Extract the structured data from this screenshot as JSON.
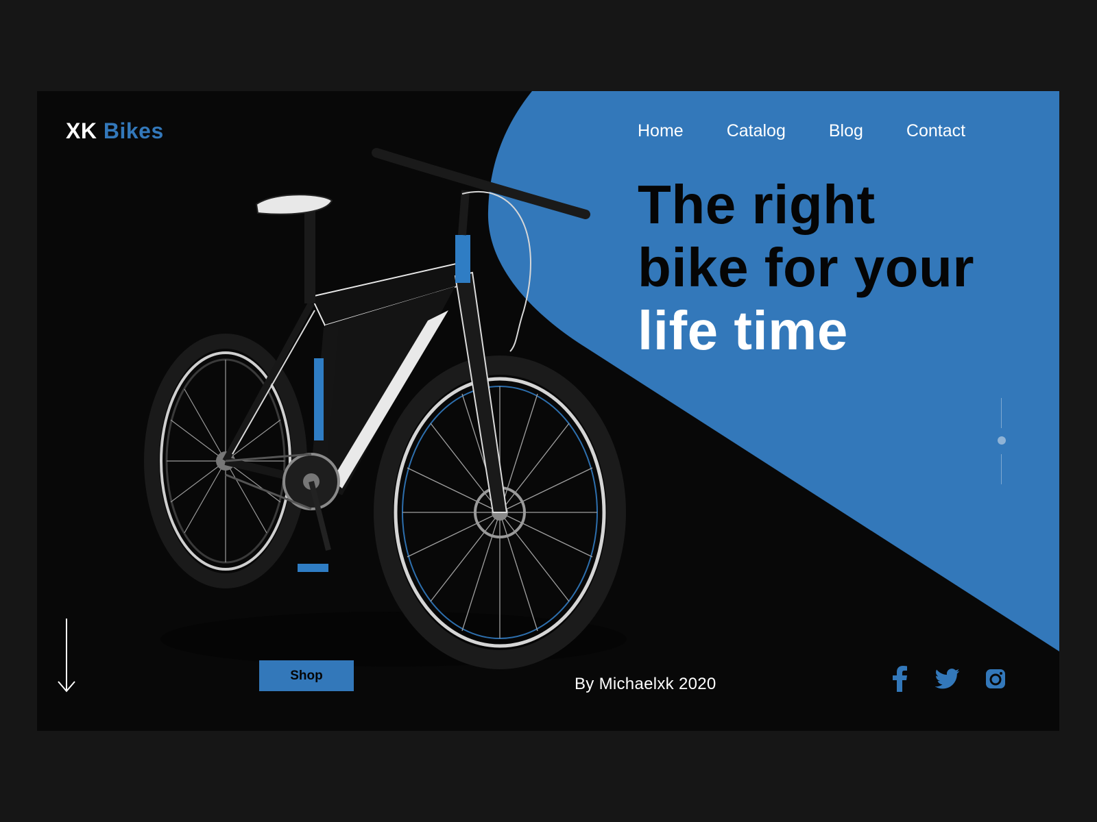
{
  "brand": {
    "name_part1": "XK",
    "name_part2": "Bikes"
  },
  "nav": {
    "items": [
      "Home",
      "Catalog",
      "Blog",
      "Contact"
    ]
  },
  "hero": {
    "line1": "The right",
    "line2": "bike for your",
    "line3": "life time"
  },
  "actions": {
    "shop_label": "Shop"
  },
  "footer": {
    "credit": "By Michaelxk 2020",
    "social_icons": [
      "facebook-icon",
      "twitter-icon",
      "instagram-icon"
    ]
  },
  "colors": {
    "accent": "#3378ba",
    "background": "#080808",
    "outer": "#161616",
    "text": "#ffffff"
  }
}
